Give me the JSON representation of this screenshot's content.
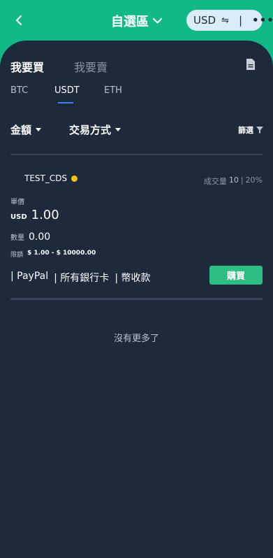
{
  "header": {
    "title": "自選區",
    "currency": "USD",
    "swap_symbol": "⇋",
    "separator": "|",
    "more_symbol": "•••",
    "accent_color": "#12b886"
  },
  "trade_tabs": [
    {
      "label": "我要買",
      "active": true
    },
    {
      "label": "我要賣",
      "active": false
    }
  ],
  "coin_tabs": [
    {
      "label": "BTC",
      "active": false
    },
    {
      "label": "USDT",
      "active": true
    },
    {
      "label": "ETH",
      "active": false
    }
  ],
  "filters": {
    "amount_label": "金額",
    "payment_method_label": "交易方式",
    "filter_label": "篩選"
  },
  "listing": {
    "merchant": "TEST_CDS",
    "volume_label": "成交量",
    "volume_value": "10",
    "volume_sep": "|",
    "completion": "20%",
    "price_label": "單價",
    "price_unit": "USD",
    "price": "1.00",
    "quantity_label": "數量",
    "quantity": "0.00",
    "limit_label": "限額",
    "limit_value": "$ 1.00 - $ 10000.00",
    "payment_methods": [
      "| PayPal",
      "| 所有銀行卡",
      "| 幣收款"
    ],
    "buy_label": "購買"
  },
  "footer": {
    "no_more_text": "沒有更多了"
  }
}
